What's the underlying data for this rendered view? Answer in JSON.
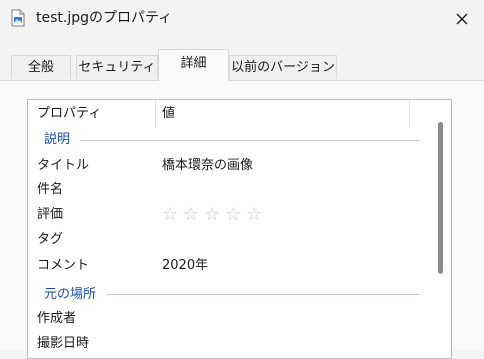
{
  "window": {
    "title": "test.jpgのプロパティ"
  },
  "tabs": [
    {
      "label": "全般"
    },
    {
      "label": "セキュリティ"
    },
    {
      "label": "詳細",
      "active": true
    },
    {
      "label": "以前のバージョン"
    }
  ],
  "table": {
    "col_property": "プロパティ",
    "col_value": "値"
  },
  "groups": {
    "description": "説明",
    "origin": "元の場所"
  },
  "rows": {
    "title": {
      "name": "タイトル",
      "value": "橋本環奈の画像"
    },
    "subject": {
      "name": "件名",
      "value": ""
    },
    "rating": {
      "name": "評価",
      "stars": [
        "☆",
        "☆",
        "☆",
        "☆",
        "☆"
      ],
      "value": 0
    },
    "tags": {
      "name": "タグ",
      "value": ""
    },
    "comment": {
      "name": "コメント",
      "value": "2020年"
    },
    "author": {
      "name": "作成者",
      "value": ""
    },
    "date_taken": {
      "name": "撮影日時",
      "value": ""
    }
  },
  "colors": {
    "group_text": "#1a4fa0",
    "star": "#c8c8c8"
  }
}
